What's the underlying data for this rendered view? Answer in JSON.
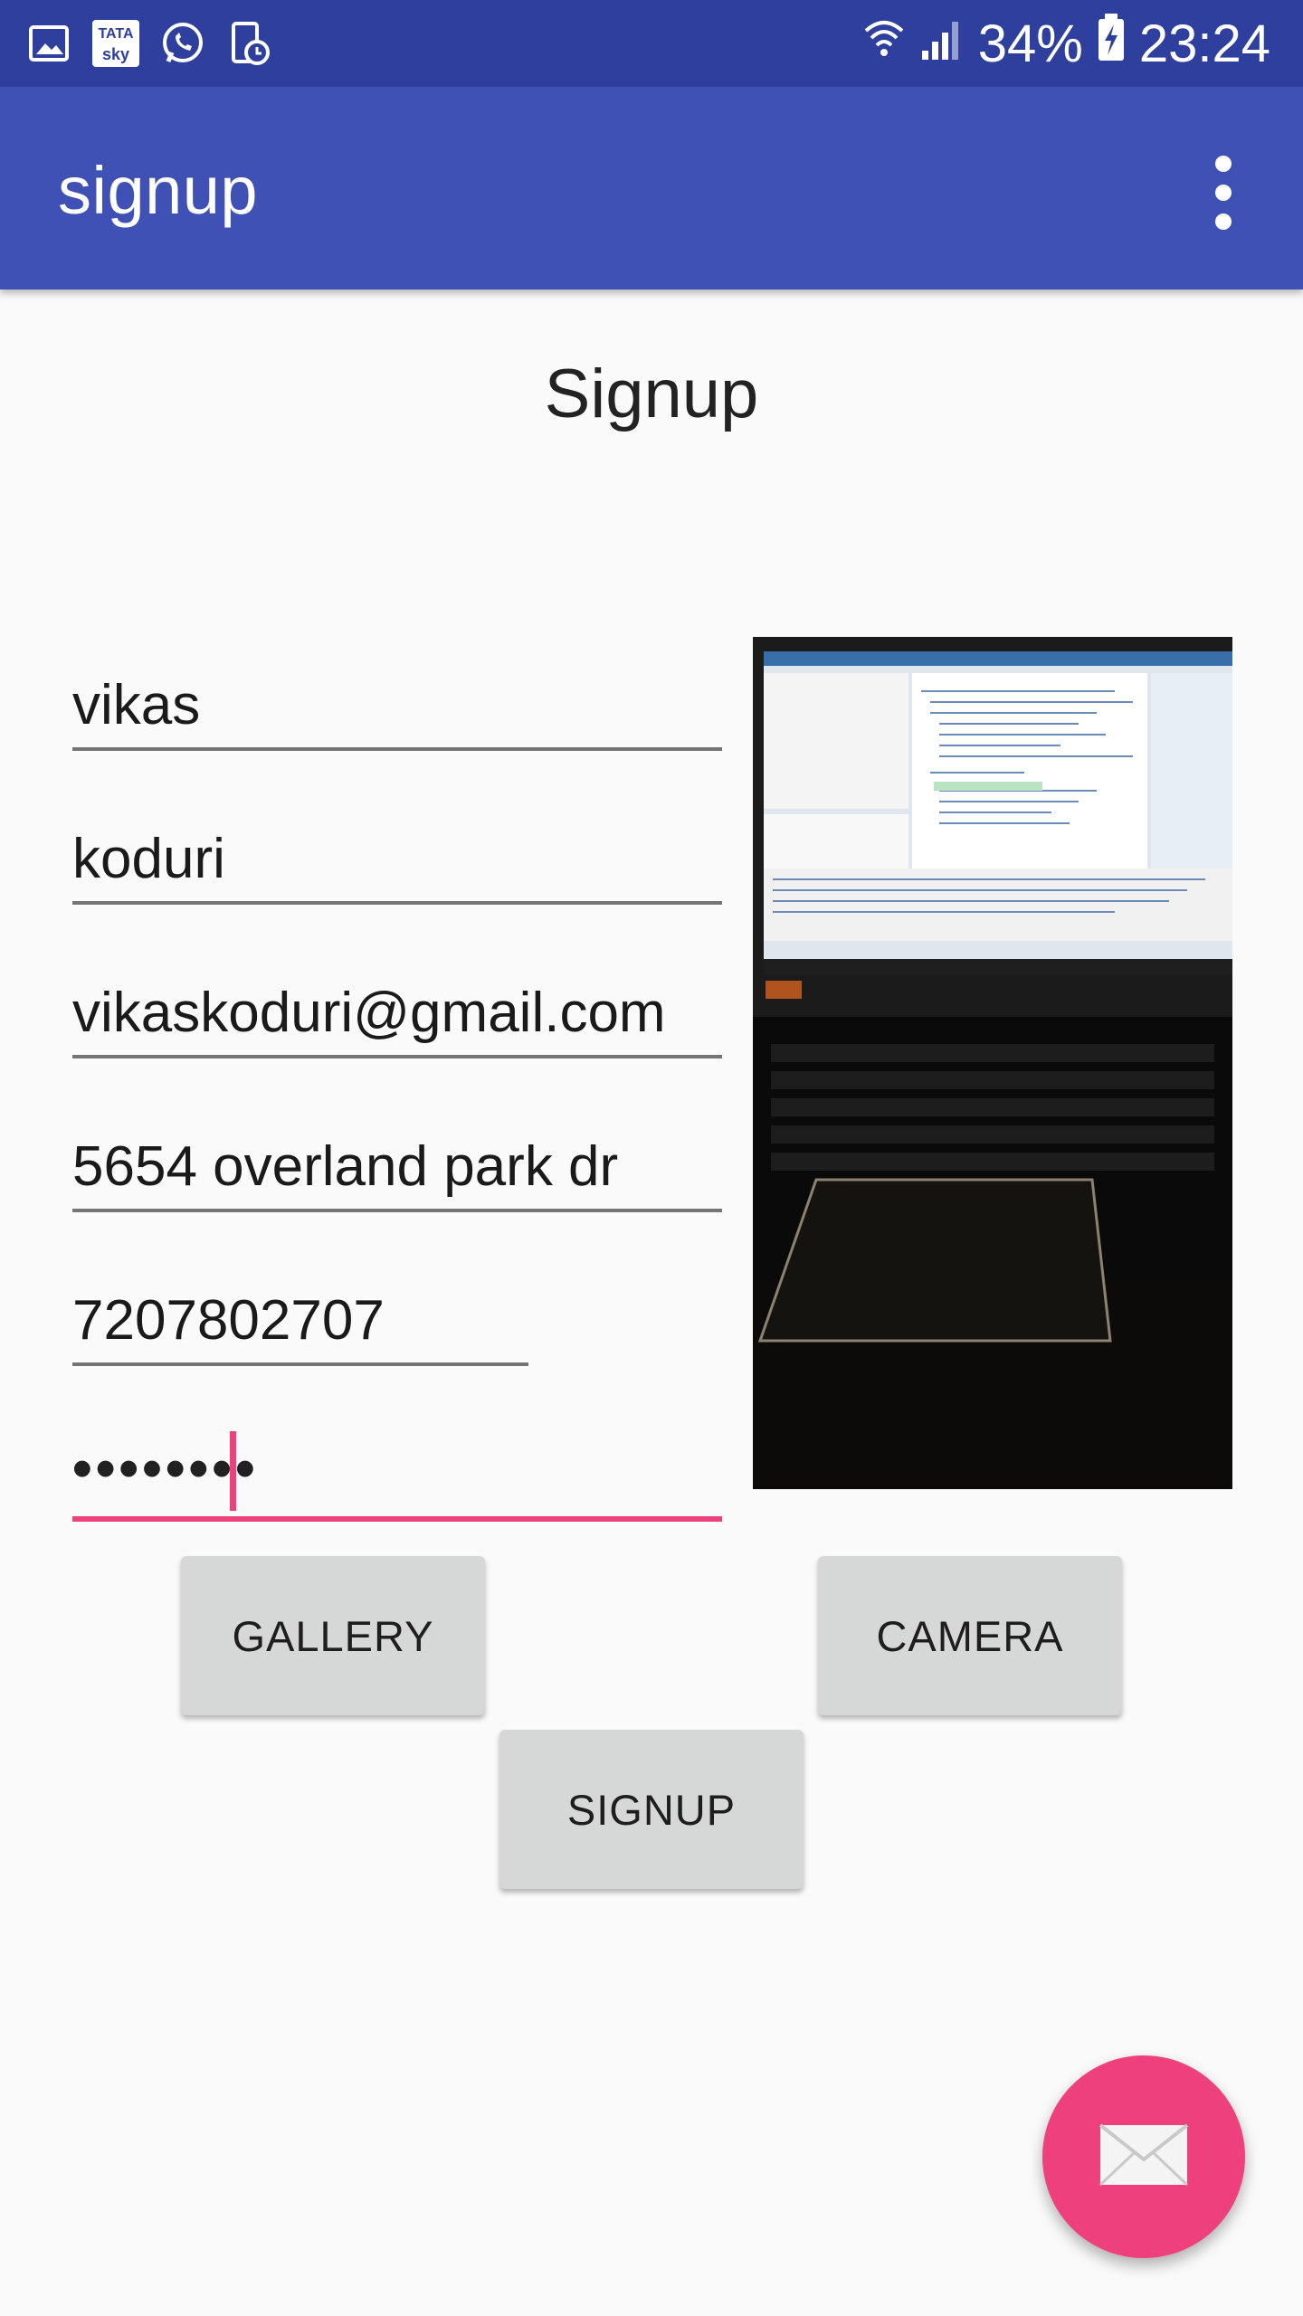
{
  "status_bar": {
    "battery": "34%",
    "time": "23:24",
    "left_icons": [
      "gallery-icon",
      "tata-sky-icon",
      "whatsapp-icon",
      "device-clock-icon"
    ],
    "tata_top": "TATA",
    "tata_bottom": "sky"
  },
  "app_bar": {
    "title": "signup"
  },
  "page": {
    "title": "Signup"
  },
  "form": {
    "first_name": "vikas",
    "last_name": "koduri",
    "email": "vikaskoduri@gmail.com",
    "address": "5654 overland park dr",
    "phone": "7207802707",
    "password_masked": "••••••••"
  },
  "buttons": {
    "gallery": "GALLERY",
    "camera": "CAMERA",
    "signup": "SIGNUP"
  },
  "colors": {
    "status_bar": "#2f3f9e",
    "app_bar": "#3f51b5",
    "accent": "#ee407c",
    "button_bg": "#d6d7d7"
  },
  "fab": {
    "icon": "mail-icon"
  }
}
